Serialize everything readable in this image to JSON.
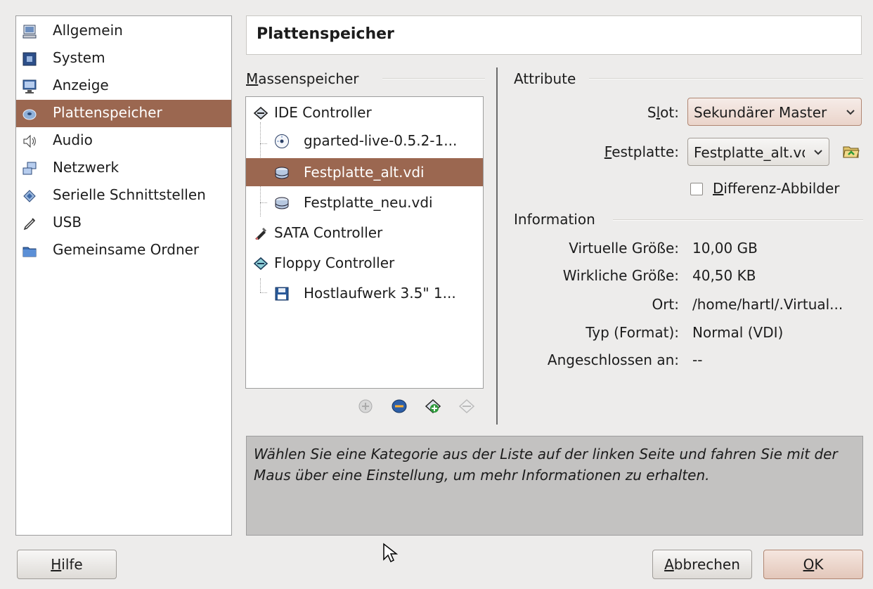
{
  "categories": [
    {
      "label": "Allgemein",
      "icon": "general-icon"
    },
    {
      "label": "System",
      "icon": "system-icon"
    },
    {
      "label": "Anzeige",
      "icon": "display-icon"
    },
    {
      "label": "Plattenspeicher",
      "icon": "storage-icon",
      "selected": true
    },
    {
      "label": "Audio",
      "icon": "audio-icon"
    },
    {
      "label": "Netzwerk",
      "icon": "network-icon"
    },
    {
      "label": "Serielle Schnittstellen",
      "icon": "serial-ports-icon"
    },
    {
      "label": "USB",
      "icon": "usb-icon"
    },
    {
      "label": "Gemeinsame Ordner",
      "icon": "shared-folders-icon"
    }
  ],
  "page": {
    "title": "Plattenspeicher"
  },
  "storage": {
    "section_label": "Massenspeicher",
    "tree": [
      {
        "label": "IDE Controller",
        "icon": "ide-controller-icon"
      },
      {
        "label": "gparted-live-0.5.2-1...",
        "icon": "cd-icon"
      },
      {
        "label": "Festplatte_alt.vdi",
        "icon": "hard-disk-icon",
        "selected": true
      },
      {
        "label": "Festplatte_neu.vdi",
        "icon": "hard-disk-icon"
      },
      {
        "label": "SATA Controller",
        "icon": "sata-controller-icon"
      },
      {
        "label": "Floppy Controller",
        "icon": "floppy-controller-icon"
      },
      {
        "label": "Hostlaufwerk 3.5\" 1...",
        "icon": "floppy-icon"
      }
    ],
    "toolbar": [
      "add-controller-icon",
      "add-attachment-icon",
      "add-hard-disk-icon",
      "remove-attachment-icon"
    ]
  },
  "attributes": {
    "section_label": "Attribute",
    "slot_label": "Slot:",
    "slot_value": "Sekundärer Master",
    "disk_label": "Festplatte:",
    "disk_value": "Festplatte_alt.vdi",
    "diff_label": "Differenz-Abbilder",
    "diff_checked": false
  },
  "information": {
    "section_label": "Information",
    "rows": [
      {
        "label": "Virtuelle Größe:",
        "value": "10,00 GB"
      },
      {
        "label": "Wirkliche Größe:",
        "value": "40,50 KB"
      },
      {
        "label": "Ort:",
        "value": "/home/hartl/.Virtual..."
      },
      {
        "label": "Typ (Format):",
        "value": "Normal (VDI)"
      },
      {
        "label": "Angeschlossen an:",
        "value": "--"
      }
    ]
  },
  "help": {
    "text": "Wählen Sie eine Kategorie aus der Liste auf der linken Seite und fahren Sie mit der Maus über eine Einstellung, um mehr Informationen zu erhalten."
  },
  "buttons": {
    "help": "Hilfe",
    "cancel": "Abbrechen",
    "ok": "OK"
  },
  "colors": {
    "selection": "#9b6750",
    "window": "#edeceb",
    "help_bg": "#c3c2c1"
  }
}
